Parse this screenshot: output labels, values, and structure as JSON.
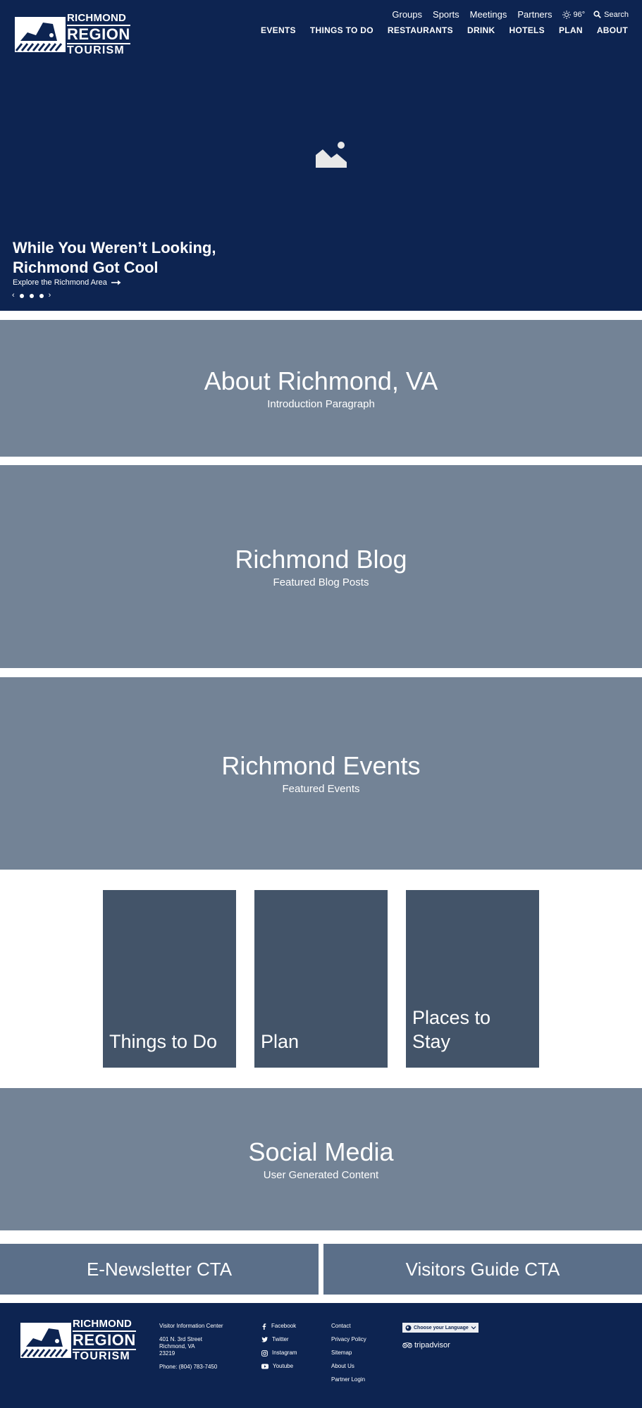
{
  "brand": {
    "line1": "RICHMOND",
    "line2": "REGION",
    "line3": "TOURISM"
  },
  "utility_nav": [
    "Groups",
    "Sports",
    "Meetings",
    "Partners"
  ],
  "weather": {
    "temp": "96°",
    "icon": "sun-icon"
  },
  "search_label": "Search",
  "main_nav": [
    "EVENTS",
    "THINGS TO DO",
    "RESTAURANTS",
    "DRINK",
    "HOTELS",
    "PLAN",
    "ABOUT"
  ],
  "hero": {
    "title": "While You Weren’t Looking, Richmond Got Cool",
    "link": "Explore the Richmond Area",
    "icon": "image-placeholder-icon",
    "background": "#0d2451"
  },
  "sections": {
    "about": {
      "title": "About Richmond, VA",
      "subtitle": "Introduction Paragraph"
    },
    "blog": {
      "title": "Richmond Blog",
      "subtitle": "Featured Blog Posts"
    },
    "events": {
      "title": "Richmond Events",
      "subtitle": "Featured Events"
    },
    "social": {
      "title": "Social Media",
      "subtitle": "User Generated Content"
    }
  },
  "cards": [
    "Things to Do",
    "Plan",
    "Places to Stay"
  ],
  "cta": {
    "newsletter": "E-Newsletter CTA",
    "guide": "Visitors Guide CTA"
  },
  "footer": {
    "address": {
      "name": "Visitor Information Center",
      "street": "401 N. 3rd Street",
      "city": "Richmond, VA",
      "zip": "23219",
      "phone": "Phone:  (804) 783-7450"
    },
    "social": [
      "Facebook",
      "Twitter",
      "Instagram",
      "Youtube"
    ],
    "links": [
      "Contact",
      "Privacy Policy",
      "Sitemap",
      "About Us",
      "Partner Login"
    ],
    "language": "Choose your Language",
    "tripadvisor": "tripadvisor"
  },
  "colors": {
    "navy": "#0d2451",
    "section_grey": "#738396",
    "card": "#435469",
    "cta": "#5b6f89"
  }
}
